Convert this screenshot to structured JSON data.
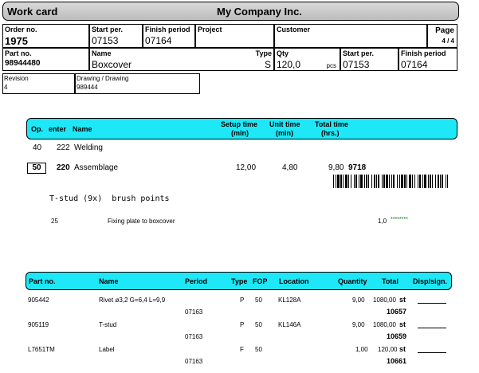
{
  "header": {
    "title": "Work card",
    "company": "My Company Inc."
  },
  "top_grid": {
    "order_no_label": "Order no.",
    "order_no": "1975",
    "start_per_label": "Start per.",
    "start_per": "07153",
    "finish_period_label": "Finish period",
    "finish_period": "07164",
    "project_label": "Project",
    "customer_label": "Customer",
    "page_label": "Page",
    "page_value": "4 / 4",
    "part_no_label": "Part no.",
    "part_no": "98944480",
    "name_label": "Name",
    "name": "Boxcover",
    "type_label": "Type",
    "type": "S",
    "qty_label": "Qty",
    "qty": "120,0",
    "qty_unit": "pcs",
    "start_per2_label": "Start per.",
    "start_per2": "07153",
    "finish_period2_label": "Finish period",
    "finish_period2": "07164",
    "revision_label": "Revision",
    "revision": "4",
    "drawing_label": "Drawing / Drawing",
    "drawing": "989444"
  },
  "ops_header": {
    "op": "Op.",
    "enter": "enter",
    "name": "Name",
    "setup_time": "Setup time",
    "setup_unit": "(min)",
    "unit_time": "Unit time",
    "unit_unit": "(min)",
    "total_time": "Total time",
    "total_unit": "(hrs.)"
  },
  "operations": [
    {
      "op": "40",
      "enter": "222",
      "name": "Welding"
    },
    {
      "op": "50",
      "enter": "220",
      "name": "Assemblage",
      "setup": "12,00",
      "unit": "4,80",
      "total": "9,80",
      "code": "9718"
    }
  ],
  "note": "T-stud (9x)  brush points",
  "sub_line": {
    "num": "25",
    "text": "Fixing plate to boxcover",
    "qty": "1,0",
    "stars": "********"
  },
  "parts_header": {
    "part_no": "Part no.",
    "name": "Name",
    "period": "Period",
    "type": "Type",
    "fop": "FOP",
    "location": "Location",
    "quantity": "Quantity",
    "total": "Total",
    "disp": "Disp/sign."
  },
  "parts": [
    {
      "part_no": "905442",
      "name": "Rivet ø3,2 G=6,4 L=9,9",
      "period": "07163",
      "type": "P",
      "fop": "50",
      "location": "KL128A",
      "quantity": "9,00",
      "total": "1080,00",
      "unit": "st",
      "code": "10657"
    },
    {
      "part_no": "905119",
      "name": "T-stud",
      "period": "07163",
      "type": "P",
      "fop": "50",
      "location": "KL146A",
      "quantity": "9,00",
      "total": "1080,00",
      "unit": "st",
      "code": "10659"
    },
    {
      "part_no": "L7651TM",
      "name": "Label",
      "period": "07163",
      "type": "F",
      "fop": "50",
      "location": "",
      "quantity": "1,00",
      "total": "120,00",
      "unit": "st",
      "code": "10661"
    }
  ]
}
